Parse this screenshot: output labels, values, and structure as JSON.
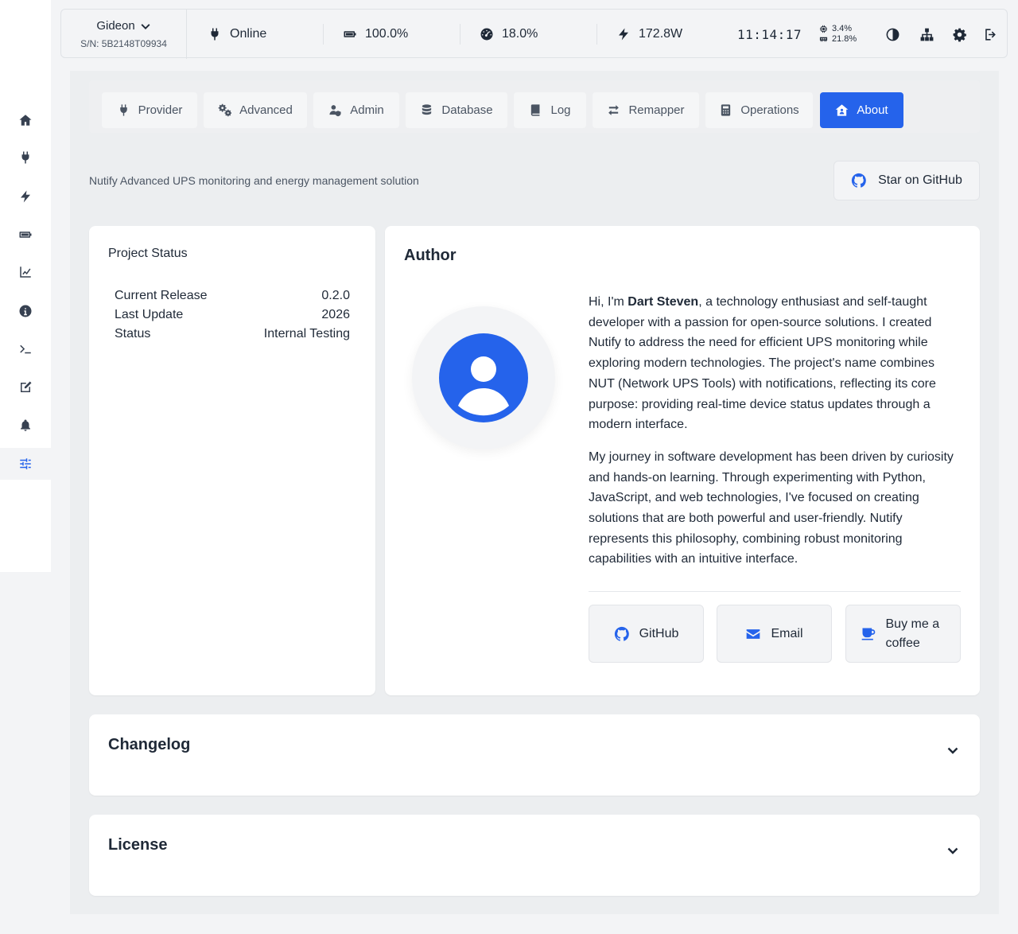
{
  "header": {
    "device_name": "Gideon",
    "serial": "S/N: 5B2148T09934",
    "status": "Online",
    "battery": "100.0%",
    "load": "18.0%",
    "power": "172.8W",
    "clock": "11:14:17",
    "cpu_usage": "3.4%",
    "ram_usage": "21.8%"
  },
  "sidebar": {
    "items": [
      {
        "icon": "home-icon"
      },
      {
        "icon": "plug-icon"
      },
      {
        "icon": "bolt-icon"
      },
      {
        "icon": "battery-icon"
      },
      {
        "icon": "chart-line-icon"
      },
      {
        "icon": "info-icon"
      },
      {
        "icon": "terminal-icon"
      },
      {
        "icon": "edit-icon"
      },
      {
        "icon": "bell-icon"
      },
      {
        "icon": "sliders-icon",
        "active": true
      }
    ]
  },
  "tabs": [
    {
      "label": "Provider",
      "icon": "plug-icon"
    },
    {
      "label": "Advanced",
      "icon": "cogs-icon"
    },
    {
      "label": "Admin",
      "icon": "user-shield-icon"
    },
    {
      "label": "Database",
      "icon": "database-icon"
    },
    {
      "label": "Log",
      "icon": "book-icon"
    },
    {
      "label": "Remapper",
      "icon": "exchange-icon"
    },
    {
      "label": "Operations",
      "icon": "calculator-icon"
    },
    {
      "label": "About",
      "icon": "house-user-icon",
      "active": true
    }
  ],
  "about": {
    "tagline": "Nutify Advanced UPS monitoring and energy management solution",
    "star_button": "Star on GitHub",
    "project_status": {
      "title": "Project Status",
      "rows": [
        {
          "label": "Current Release",
          "value": "0.2.0"
        },
        {
          "label": "Last Update",
          "value": "2026"
        },
        {
          "label": "Status",
          "value": "Internal Testing"
        }
      ]
    },
    "author": {
      "title": "Author",
      "bio1_prefix": "Hi, I'm ",
      "bio1_name": "Dart Steven",
      "bio1_rest": ", a technology enthusiast and self-taught developer with a passion for open-source solutions. I created Nutify to address the need for efficient UPS monitoring while exploring modern technologies. The project's name combines NUT (Network UPS Tools) with notifications, reflecting its core purpose: providing real-time device status updates through a modern interface.",
      "bio2": "My journey in software development has been driven by curiosity and hands-on learning. Through experimenting with Python, JavaScript, and web technologies, I've focused on creating solutions that are both powerful and user-friendly. Nutify represents this philosophy, combining robust monitoring capabilities with an intuitive interface.",
      "github_label": "GitHub",
      "email_label": "Email",
      "coffee_label": "Buy me a coffee"
    },
    "changelog_title": "Changelog",
    "license_title": "License"
  },
  "colors": {
    "accent": "#2563eb",
    "text": "#1f2937",
    "muted": "#4b5563"
  }
}
